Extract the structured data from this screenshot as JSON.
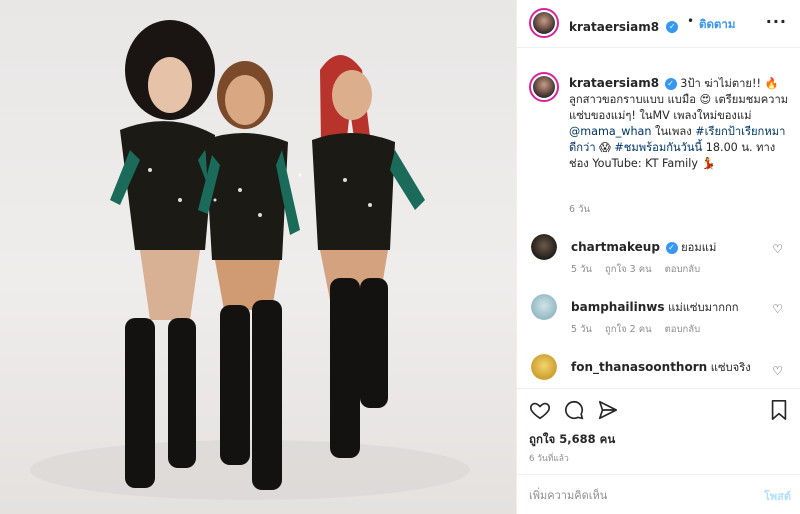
{
  "post": {
    "account": {
      "username": "krataersiam8",
      "verified": true
    },
    "follow_label": "ติดตาม",
    "menu_icon": "more-options-icon",
    "photo_alt": "Three performers posing in sequined bodysuits and thigh-high black boots",
    "caption": {
      "username": "krataersiam8",
      "verified": true,
      "part1": "3ป้า ฆ่าไม่ตาย!! 🔥 ลูกสาวขอกราบแบบ แบมือ 😍 เตรียมชมความแซ่บของแม่ๆ! ในMV เพลงใหม่ของแม่ ",
      "mention": "@mama_whan",
      "part2": " ในเพลง ",
      "hashtag1": "#เรียกป้าเรียกหมาดีกว่า",
      "part3": " 😱 ",
      "hashtag2": "#ชมพร้อมกันวันนี้",
      "part4": " 18.00 น. ทาง ช่อง YouTube: KT Family 💃",
      "time": "6 วัน"
    },
    "comments": [
      {
        "username": "chartmakeup",
        "verified": true,
        "text": "ยอมแม่",
        "time": "5 วัน",
        "likes": "ถูกใจ 3 คน",
        "reply": "ตอบกลับ"
      },
      {
        "username": "bamphailinws",
        "verified": false,
        "text": "แม่แซ่บมากกก",
        "time": "5 วัน",
        "likes": "ถูกใจ 2 คน",
        "reply": "ตอบกลับ"
      },
      {
        "username": "fon_thanasoonthorn",
        "verified": false,
        "text": "แซ่บจริง",
        "time": "",
        "likes": "",
        "reply": ""
      }
    ],
    "likes_label": "ถูกใจ 5,688 คน",
    "age_label": "6 วันที่แล้ว",
    "add_comment_placeholder": "เพิ่มความคิดเห็น",
    "post_button": "โพสต์"
  },
  "colors": {
    "link": "#003569",
    "accent": "#3897f0",
    "muted": "#8e8e8e",
    "post_disabled": "#b2dffc"
  }
}
